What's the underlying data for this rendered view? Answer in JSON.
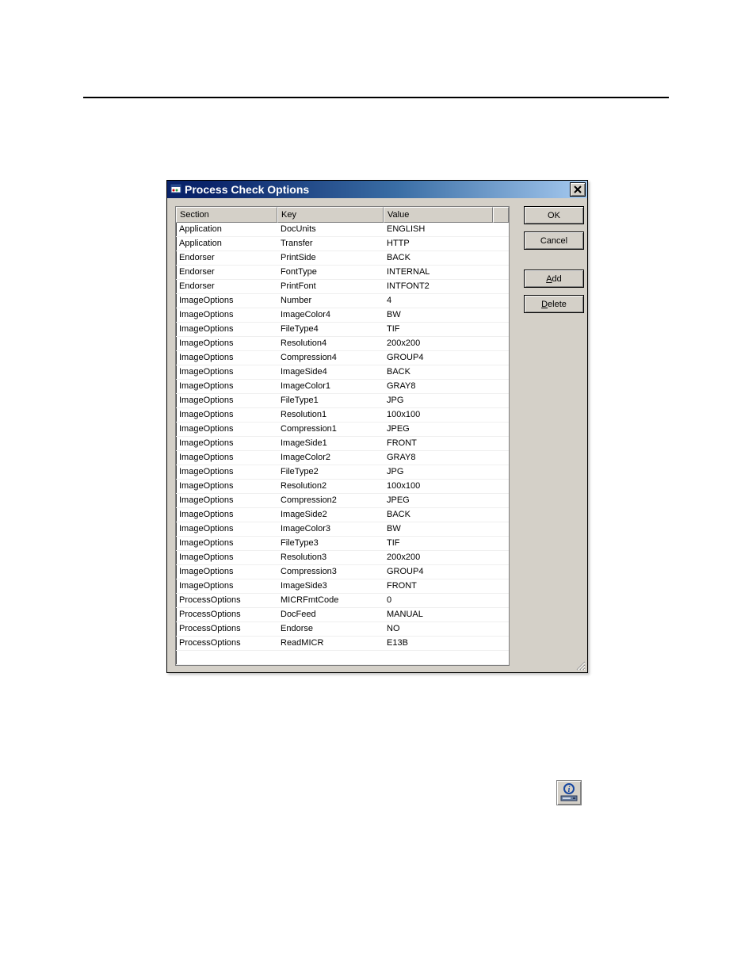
{
  "titlebar": {
    "title": "Process Check Options"
  },
  "buttons": {
    "ok": "OK",
    "cancel": "Cancel",
    "add_prefix": "A",
    "add_rest": "dd",
    "delete_prefix": "D",
    "delete_rest": "elete"
  },
  "listview": {
    "headers": {
      "section": "Section",
      "key": "Key",
      "value": "Value"
    },
    "rows": [
      {
        "section": "Application",
        "key": "DocUnits",
        "value": "ENGLISH"
      },
      {
        "section": "Application",
        "key": "Transfer",
        "value": "HTTP"
      },
      {
        "section": "Endorser",
        "key": "PrintSide",
        "value": "BACK"
      },
      {
        "section": "Endorser",
        "key": "FontType",
        "value": "INTERNAL"
      },
      {
        "section": "Endorser",
        "key": "PrintFont",
        "value": "INTFONT2"
      },
      {
        "section": "ImageOptions",
        "key": "Number",
        "value": "4"
      },
      {
        "section": "ImageOptions",
        "key": "ImageColor4",
        "value": "BW"
      },
      {
        "section": "ImageOptions",
        "key": "FileType4",
        "value": "TIF"
      },
      {
        "section": "ImageOptions",
        "key": "Resolution4",
        "value": "200x200"
      },
      {
        "section": "ImageOptions",
        "key": "Compression4",
        "value": "GROUP4"
      },
      {
        "section": "ImageOptions",
        "key": "ImageSide4",
        "value": "BACK"
      },
      {
        "section": "ImageOptions",
        "key": "ImageColor1",
        "value": "GRAY8"
      },
      {
        "section": "ImageOptions",
        "key": "FileType1",
        "value": "JPG"
      },
      {
        "section": "ImageOptions",
        "key": "Resolution1",
        "value": "100x100"
      },
      {
        "section": "ImageOptions",
        "key": "Compression1",
        "value": "JPEG"
      },
      {
        "section": "ImageOptions",
        "key": "ImageSide1",
        "value": "FRONT"
      },
      {
        "section": "ImageOptions",
        "key": "ImageColor2",
        "value": "GRAY8"
      },
      {
        "section": "ImageOptions",
        "key": "FileType2",
        "value": "JPG"
      },
      {
        "section": "ImageOptions",
        "key": "Resolution2",
        "value": "100x100"
      },
      {
        "section": "ImageOptions",
        "key": "Compression2",
        "value": "JPEG"
      },
      {
        "section": "ImageOptions",
        "key": "ImageSide2",
        "value": "BACK"
      },
      {
        "section": "ImageOptions",
        "key": "ImageColor3",
        "value": "BW"
      },
      {
        "section": "ImageOptions",
        "key": "FileType3",
        "value": "TIF"
      },
      {
        "section": "ImageOptions",
        "key": "Resolution3",
        "value": "200x200"
      },
      {
        "section": "ImageOptions",
        "key": "Compression3",
        "value": "GROUP4"
      },
      {
        "section": "ImageOptions",
        "key": "ImageSide3",
        "value": "FRONT"
      },
      {
        "section": "ProcessOptions",
        "key": "MICRFmtCode",
        "value": "0"
      },
      {
        "section": "ProcessOptions",
        "key": "DocFeed",
        "value": "MANUAL"
      },
      {
        "section": "ProcessOptions",
        "key": "Endorse",
        "value": "NO"
      },
      {
        "section": "ProcessOptions",
        "key": "ReadMICR",
        "value": "E13B"
      }
    ]
  }
}
